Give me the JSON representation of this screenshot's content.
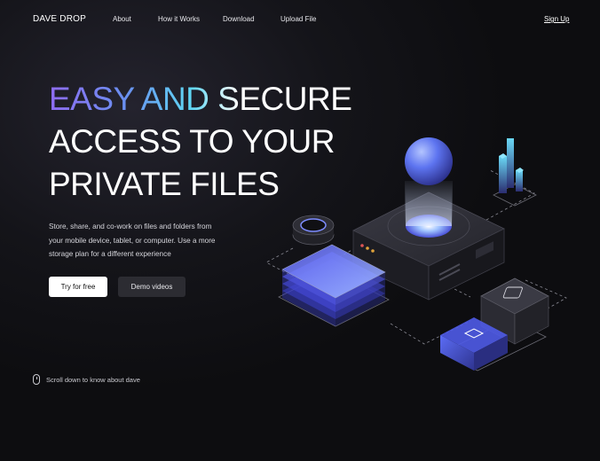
{
  "nav": {
    "logo": "DAVE DROP",
    "links": [
      "About",
      "How it Works",
      "Download",
      "Upload File"
    ],
    "signup": "Sign Up"
  },
  "hero": {
    "title_gradient": "EASY AND S",
    "title_line1_rest": "ECURE",
    "title_line2": "ACCESS TO YOUR",
    "title_line3": "PRIVATE FILES",
    "description": "Store, share, and co-work on files and folders from your mobile device, tablet, or computer. Use a more storage plan for a different experience",
    "primary_button": "Try for free",
    "secondary_button": "Demo videos"
  },
  "scroll_hint": {
    "text": "Scroll down to know about dave"
  },
  "colors": {
    "background": "#141419",
    "gradient_start": "#8f6cf2",
    "gradient_mid": "#5fd6f3",
    "accent_blue": "#6f7cff"
  },
  "icons": [
    "mouse-icon",
    "file-lock-icon"
  ]
}
